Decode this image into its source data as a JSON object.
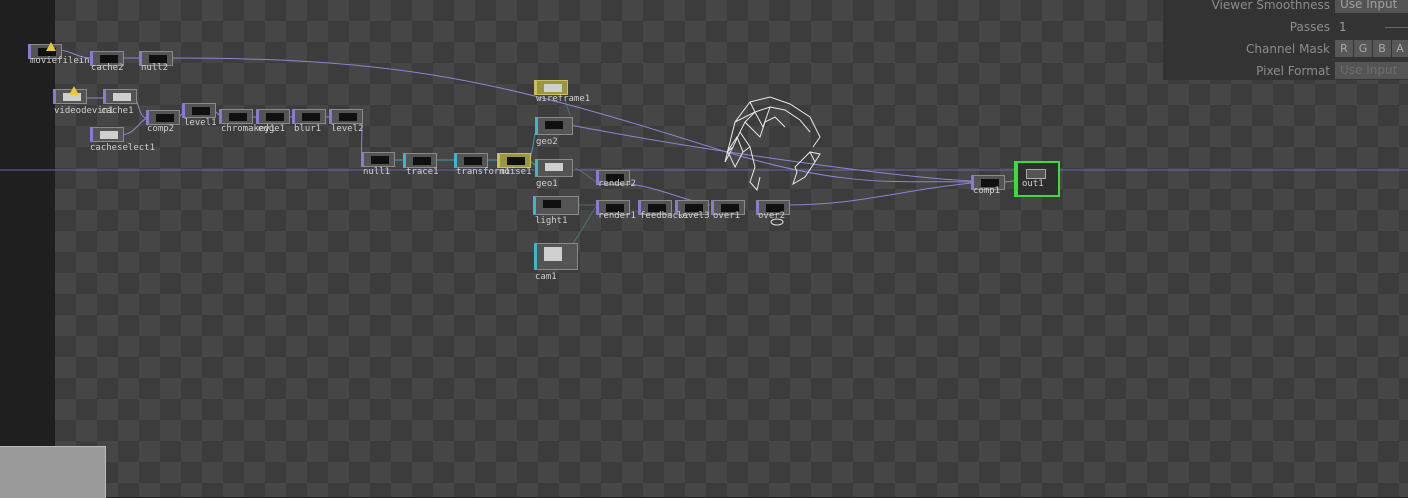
{
  "params": {
    "viewer_smoothness_label": "Viewer Smoothness",
    "viewer_smoothness_value": "Use Input",
    "passes_label": "Passes",
    "passes_value": "1",
    "channel_mask_label": "Channel Mask",
    "channels": [
      "R",
      "G",
      "B",
      "A"
    ],
    "pixel_format_label": "Pixel Format",
    "pixel_format_value": "Use Input"
  },
  "nodes": {
    "moviefilein": "moviefilein1",
    "cache2": "cache2",
    "null2": "null2",
    "videodevin": "videodevin1",
    "cache1": "cache1",
    "comp2": "comp2",
    "level1": "level1",
    "chromakey1": "chromakey1",
    "edge1": "edge1",
    "blur1": "blur1",
    "level2": "level2",
    "cacheselect1": "cacheselect1",
    "null1": "null1",
    "trace1": "trace1",
    "transform1": "transform1",
    "noise1": "noise1",
    "wireframe1": "wireframe1",
    "geo2": "geo2",
    "geo1": "geo1",
    "light1": "light1",
    "cam1": "cam1",
    "render2": "render2",
    "render1": "render1",
    "feedback1": "feedback1",
    "level3": "level3",
    "over1": "over1",
    "over2": "over2",
    "comp1": "comp1",
    "out1": "out1"
  },
  "colors": {
    "top_family": "#8a7ad0",
    "sop_family": "#3fb7c9",
    "out_highlight": "#3ddc3d",
    "warning": "#e8c93a",
    "wire": "#8b86cf"
  }
}
